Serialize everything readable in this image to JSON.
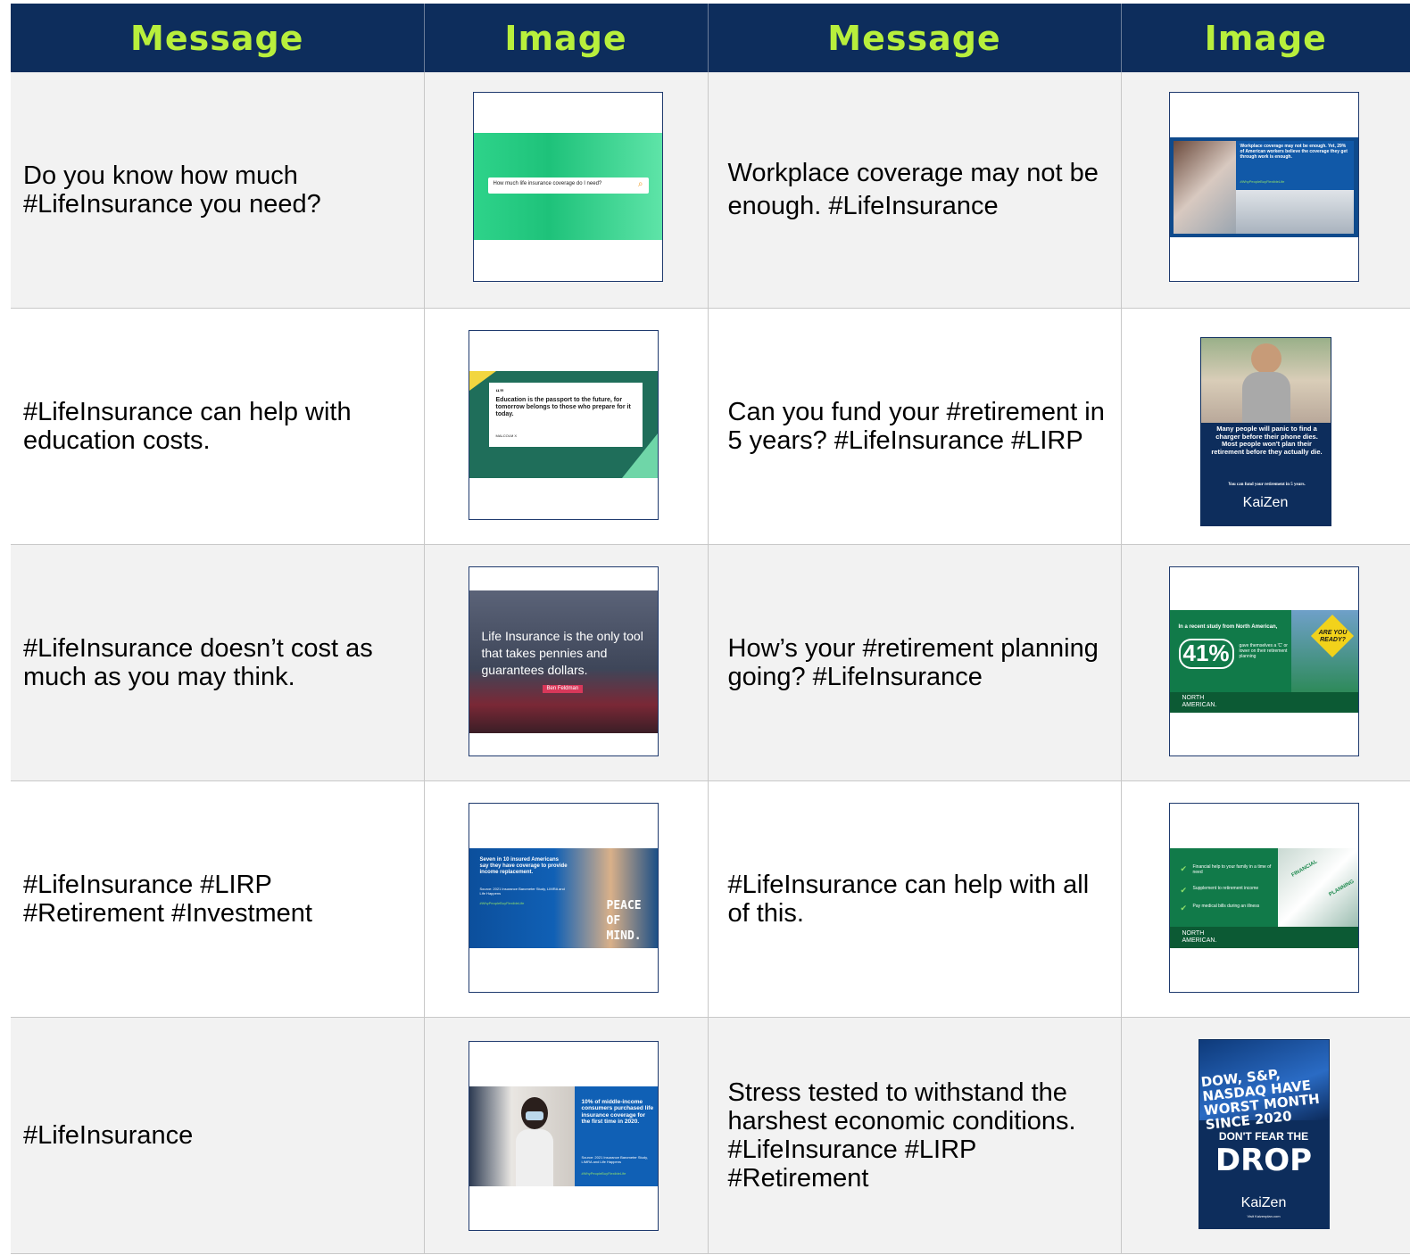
{
  "headers": [
    "Message",
    "Image",
    "Message",
    "Image"
  ],
  "rows": [
    {
      "left_message": "Do you know how much #LifeInsurance you need?",
      "left_image": {
        "text": "How much life insurance coverage do I need?"
      },
      "right_message": "Workplace coverage may not be enough. #LifeInsurance",
      "right_image": {
        "text": "Workplace coverage may not be enough. Yet, 29% of American workers believe the coverage they get through work is enough.",
        "tag": "#WhyPeopleBuyFlexibleLife"
      }
    },
    {
      "left_message": "#LifeInsurance can help with education costs.",
      "left_image": {
        "quote_mark": "“”",
        "text": "Education is the passport to the future, for tomorrow belongs to those who prepare for it today.",
        "author": "MALCOLM X"
      },
      "right_message": "Can you fund your #retirement in 5 years? #LifeInsurance #LIRP",
      "right_image": {
        "text": "Many people will panic to find a charger before their phone dies. Most people won't plan their retirement before they actually die.",
        "sub": "You can fund your retirement in 5 years.",
        "logo": "KaiZen"
      }
    },
    {
      "left_message": "#LifeInsurance doesn’t cost as much as you may think.",
      "left_image": {
        "text": "Life Insurance is the only tool that takes pennies and guarantees dollars.",
        "author": "Ben Feldman"
      },
      "right_message": "How’s your #retirement planning going? #LifeInsurance",
      "right_image": {
        "intro": "In a recent study from North American,",
        "percent": "41%",
        "detail": "gave themselves a 'C' or lower on their retirement planning",
        "sign": "ARE YOU READY?",
        "logo": "NORTH AMERICAN."
      }
    },
    {
      "left_message": "#LifeInsurance #LIRP #Retirement #Investment",
      "left_image": {
        "text": "Seven in 10 insured Americans say they have coverage to provide income replacement.",
        "source": "Source: 2021 Insurance Barometer Study, LIMRA and Life Happens",
        "tag": "#WhyPeopleBuyFlexibleLife",
        "headline": "PEACE OF MIND."
      },
      "right_message": "#LifeInsurance can help with all of this.",
      "right_image": {
        "items": [
          "Financial help to your family in a time of need",
          "Supplement to retirement income",
          "Pay medical bills during an illness"
        ],
        "puzzle": [
          "FINANCIAL",
          "PLANNING"
        ],
        "logo": "NORTH AMERICAN."
      }
    },
    {
      "left_message": "#LifeInsurance",
      "left_image": {
        "text": "10% of middle-income consumers purchased life insurance coverage for the first time in 2020.",
        "source": "Source: 2021 Insurance Barometer Study, LIMRA and Life Happens",
        "tag": "#WhyPeopleBuyFlexibleLife"
      },
      "right_message": "Stress tested to withstand the harshest economic conditions. #LifeInsurance #LIRP #Retirement",
      "right_image": {
        "headline": "DOW, S&P, NASDAQ HAVE WORST MONTH SINCE 2020",
        "line1": "DON'T FEAR THE",
        "line2": "DROP",
        "logo": "KaiZen",
        "url": "Visit Kaizenplan.com"
      }
    }
  ],
  "colors": {
    "header_bg": "#0d2d5c",
    "header_text": "#b8ef3c",
    "odd_row": "#f2f2f2",
    "even_row": "#ffffff"
  }
}
